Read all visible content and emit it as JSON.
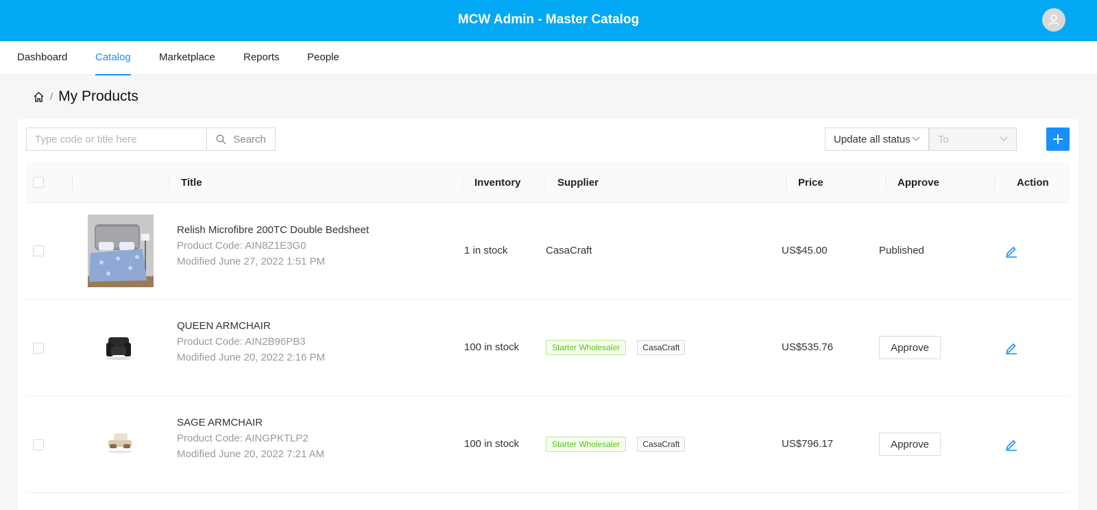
{
  "header": {
    "title": "MCW Admin - Master Catalog",
    "avatar_icon": "user-icon"
  },
  "nav": {
    "tabs": [
      "Dashboard",
      "Catalog",
      "Marketplace",
      "Reports",
      "People"
    ],
    "active": "Catalog"
  },
  "breadcrumb": {
    "home_icon": "home-icon",
    "separator": "/",
    "title": "My Products"
  },
  "toolbar": {
    "search_placeholder": "Type code or title here",
    "search_label": "Search",
    "status_select": "Update all status",
    "to_select": "To",
    "add_icon": "plus-icon"
  },
  "table": {
    "headers": {
      "title": "Title",
      "inventory": "Inventory",
      "supplier": "Supplier",
      "price": "Price",
      "approve": "Approve",
      "action": "Action"
    },
    "rows": [
      {
        "title": "Relish Microfibre 200TC Double Bedsheet",
        "code": "Product Code: AIN8Z1E3G0",
        "modified": "Modified June 27, 2022 1:51 PM",
        "inventory": "1 in stock",
        "supplier": "CasaCraft",
        "price": "US$45.00",
        "approve": "Published",
        "image": "bedsheet-image"
      },
      {
        "title": "QUEEN ARMCHAIR",
        "code": "Product Code: AIN2B96PB3",
        "modified": "Modified June 20, 2022 2:16 PM",
        "inventory": "100 in stock",
        "supplier_tag": "Starter Wholesaler",
        "supplier": "CasaCraft",
        "price": "US$535.76",
        "approve": "Approve",
        "image": "black-armchair-image"
      },
      {
        "title": "SAGE ARMCHAIR",
        "code": "Product Code: AINGPKTLP2",
        "modified": "Modified June 20, 2022 7:21 AM",
        "inventory": "100 in stock",
        "supplier_tag": "Starter Wholesaler",
        "supplier": "CasaCraft",
        "price": "US$796.17",
        "approve": "Approve",
        "image": "sage-armchair-image"
      }
    ]
  },
  "colors": {
    "brand": "#03a9f4",
    "accent": "#1890ff",
    "tag_green": "#52c41a"
  }
}
